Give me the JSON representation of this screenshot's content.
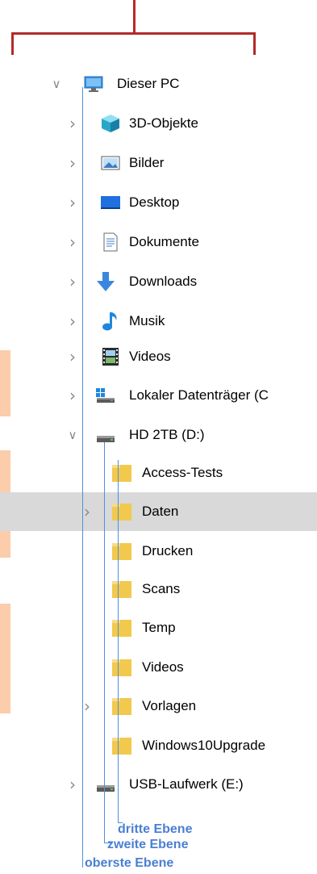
{
  "tree": {
    "root": {
      "label": "Dieser PC",
      "icon": "monitor-icon",
      "expanded": true
    },
    "level2": [
      {
        "label": "3D-Objekte",
        "icon": "cube-icon",
        "expanded": false
      },
      {
        "label": "Bilder",
        "icon": "pictures-icon",
        "expanded": false
      },
      {
        "label": "Desktop",
        "icon": "desktop-icon",
        "expanded": false
      },
      {
        "label": "Dokumente",
        "icon": "documents-icon",
        "expanded": false
      },
      {
        "label": "Downloads",
        "icon": "download-arrow-icon",
        "expanded": false
      },
      {
        "label": "Musik",
        "icon": "music-note-icon",
        "expanded": false
      },
      {
        "label": "Videos",
        "icon": "film-icon",
        "expanded": false
      },
      {
        "label": "Lokaler Datenträger (C",
        "icon": "windows-drive-icon",
        "expanded": false
      },
      {
        "label": "HD 2TB (D:)",
        "icon": "drive-icon",
        "expanded": true
      }
    ],
    "level3": [
      {
        "label": "Access-Tests",
        "icon": "folder-icon",
        "has_chevron": false,
        "selected": false
      },
      {
        "label": "Daten",
        "icon": "folder-icon",
        "has_chevron": true,
        "selected": true
      },
      {
        "label": "Drucken",
        "icon": "folder-icon",
        "has_chevron": false,
        "selected": false
      },
      {
        "label": "Scans",
        "icon": "folder-icon",
        "has_chevron": false,
        "selected": false
      },
      {
        "label": "Temp",
        "icon": "folder-icon",
        "has_chevron": false,
        "selected": false
      },
      {
        "label": "Videos",
        "icon": "folder-icon",
        "has_chevron": false,
        "selected": false
      },
      {
        "label": "Vorlagen",
        "icon": "folder-icon",
        "has_chevron": true,
        "selected": false
      },
      {
        "label": "Windows10Upgrade",
        "icon": "folder-icon",
        "has_chevron": false,
        "selected": false
      }
    ],
    "after": {
      "label": "USB-Laufwerk (E:)",
      "icon": "drive-icon",
      "expanded": false
    }
  },
  "annotations": {
    "third": "dritte Ebene",
    "second": "zweite Ebene",
    "top": "oberste Ebene"
  },
  "colors": {
    "bracket": "#b22a2a",
    "guide_lines": "#4f8fdc",
    "annotation_text": "#4a7fd1",
    "highlight_box": "#fbcdaa",
    "selection": "#d9d9d9",
    "folder": "#f2c94c"
  }
}
